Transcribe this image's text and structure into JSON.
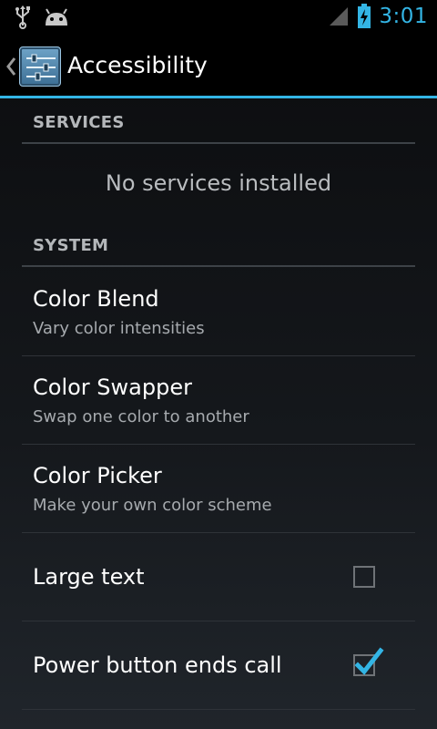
{
  "status_bar": {
    "time": "3:01",
    "icons": [
      "usb-icon",
      "android-icon",
      "signal-icon",
      "battery-charging-icon"
    ],
    "accent_color": "#33b5e5"
  },
  "action_bar": {
    "title": "Accessibility",
    "icon": "accessibility-settings-icon",
    "up_icon": "back-caret-icon"
  },
  "sections": [
    {
      "header": "SERVICES",
      "empty_text": "No services installed"
    },
    {
      "header": "SYSTEM",
      "items": [
        {
          "title": "Color Blend",
          "summary": "Vary color intensities"
        },
        {
          "title": "Color Swapper",
          "summary": "Swap one color to another"
        },
        {
          "title": "Color Picker",
          "summary": "Make your own color scheme"
        },
        {
          "title": "Large text",
          "checkbox": true,
          "checked": false
        },
        {
          "title": "Power button ends call",
          "checkbox": true,
          "checked": true
        }
      ]
    }
  ]
}
